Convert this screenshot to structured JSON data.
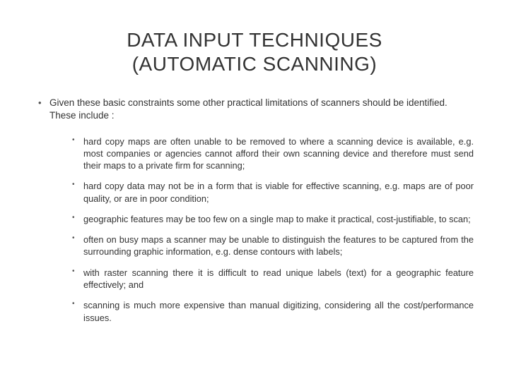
{
  "title_line1": "DATA INPUT TECHNIQUES",
  "title_line2": "(AUTOMATIC SCANNING)",
  "intro": "Given these basic constraints some other practical limitations of scanners should be identified. These include :",
  "points": [
    "hard copy maps are often unable to be removed to where a scanning device is available, e.g. most companies or agencies cannot afford their own scanning device and therefore must send their maps to a private firm for scanning;",
    "hard copy data may not be in a form that is viable for effective scanning, e.g. maps are of poor quality, or are in poor condition;",
    "geographic features may be too few on a single map to make it practical, cost-justifiable, to scan;",
    "often on busy maps a scanner may be unable to distinguish the features to be captured from the surrounding graphic information, e.g. dense contours with labels;",
    "with raster scanning there it is difficult to read unique labels (text) for a geographic feature effectively; and",
    "scanning is much more expensive than manual digitizing, considering all the cost/performance issues."
  ]
}
